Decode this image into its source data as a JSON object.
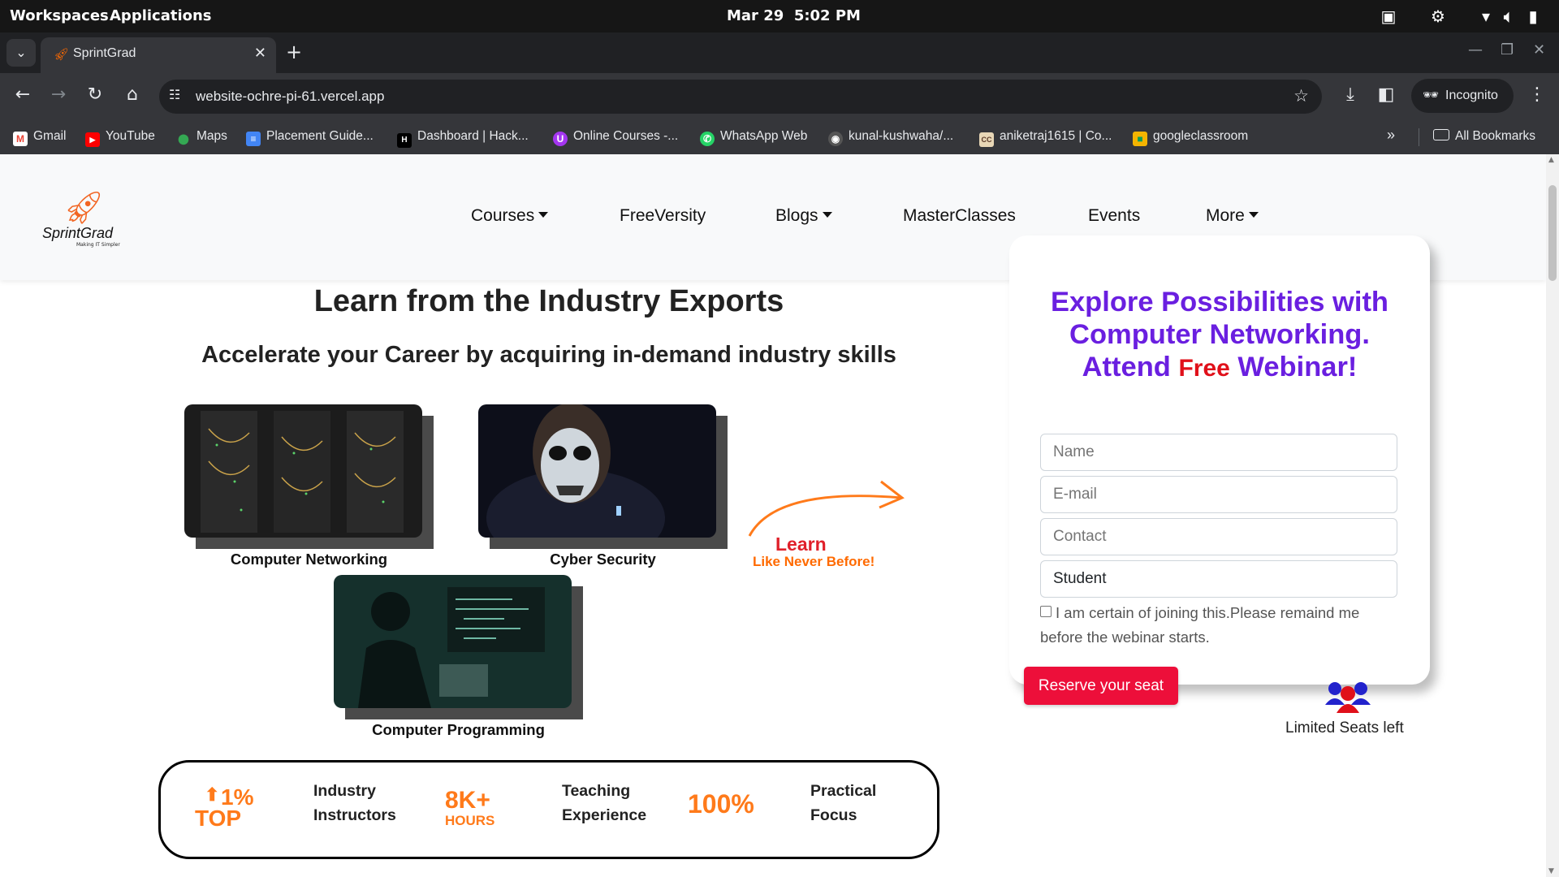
{
  "os": {
    "workspaces": "Workspaces",
    "applications": "Applications",
    "date": "Mar 29",
    "time": "5:02 PM"
  },
  "browser": {
    "tab_title": "SprintGrad",
    "url": "website-ochre-pi-61.vercel.app",
    "incognito_label": "Incognito",
    "bookmarks": [
      {
        "label": "Gmail",
        "icon": "gmail-icon"
      },
      {
        "label": "YouTube",
        "icon": "youtube-icon"
      },
      {
        "label": "Maps",
        "icon": "maps-icon"
      },
      {
        "label": "Placement Guide...",
        "icon": "docs-icon"
      },
      {
        "label": "Dashboard | Hack...",
        "icon": "hackerrank-icon"
      },
      {
        "label": "Online Courses -...",
        "icon": "udemy-icon"
      },
      {
        "label": "WhatsApp Web",
        "icon": "whatsapp-icon"
      },
      {
        "label": "kunal-kushwaha/...",
        "icon": "github-icon"
      },
      {
        "label": "aniketraj1615 | Co...",
        "icon": "codechef-icon"
      },
      {
        "label": "googleclassroom",
        "icon": "classroom-icon"
      }
    ],
    "all_bookmarks": "All Bookmarks"
  },
  "site": {
    "logo_text": "SprintGrad",
    "logo_tagline": "Making IT Simpler",
    "nav": [
      "Courses",
      "FreeVersity",
      "Blogs",
      "MasterClasses",
      "Events",
      "More"
    ]
  },
  "hero": {
    "title": "Learn from the Industry Exports",
    "subtitle": "Accelerate your Career by acquiring in-demand industry skills",
    "courses": [
      "Computer Networking",
      "Cyber Security",
      "Computer Programming"
    ],
    "arrow_line1": "Learn",
    "arrow_line2": "Like Never Before!"
  },
  "stats": [
    {
      "badge_top": "1%",
      "badge_bottom": "TOP",
      "line1": "Industry",
      "line2": "Instructors"
    },
    {
      "badge_top": "8K+",
      "badge_bottom": "HOURS",
      "line1": "Teaching",
      "line2": "Experience"
    },
    {
      "badge_top": "100%",
      "line1": "Practical",
      "line2": "Focus"
    }
  ],
  "webinar": {
    "line1": "Explore Possibilities with",
    "line2": "Computer Networking.",
    "line3_a": "Attend",
    "line3_free": "Free",
    "line3_b": "Webinar!",
    "fields": [
      "Name",
      "E-mail",
      "Contact",
      "Student"
    ],
    "checkbox_text": "I am certain of joining this.Please remaind me before the webinar starts.",
    "reserve_button": "Reserve your seat",
    "seats_text": "Limited Seats left"
  },
  "colors": {
    "accent_purple": "#6a1fe0",
    "free_red": "#e0101a",
    "reserve_red": "#ed0f3a",
    "brand_orange": "#ff7a1a"
  }
}
